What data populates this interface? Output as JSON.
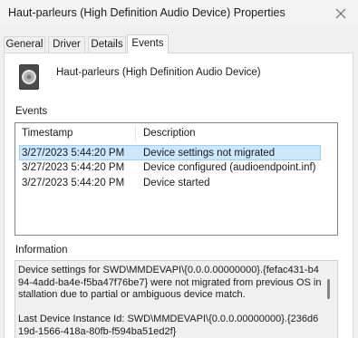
{
  "window": {
    "title": "Haut-parleurs (High Definition Audio Device) Properties",
    "close_icon": "close-icon"
  },
  "tabs": [
    {
      "label": "General",
      "active": false
    },
    {
      "label": "Driver",
      "active": false
    },
    {
      "label": "Details",
      "active": false
    },
    {
      "label": "Events",
      "active": true
    }
  ],
  "device": {
    "name": "Haut-parleurs (High Definition Audio Device)",
    "icon": "speaker-icon"
  },
  "events": {
    "section_label": "Events",
    "columns": [
      "Timestamp",
      "Description"
    ],
    "rows": [
      {
        "timestamp": "3/27/2023 5:44:20 PM",
        "description": "Device settings not migrated",
        "selected": true
      },
      {
        "timestamp": "3/27/2023 5:44:20 PM",
        "description": "Device configured (audioendpoint.inf)",
        "selected": false
      },
      {
        "timestamp": "3/27/2023 5:44:20 PM",
        "description": "Device started",
        "selected": false
      }
    ]
  },
  "information": {
    "section_label": "Information",
    "text": "Device settings for SWD\\MMDEVAPI\\{0.0.0.00000000}.{fefac431-b494-4add-ba4e-f5ba47f76be7} were not migrated from previous OS installation due to partial or ambiguous device match.\n\nLast Device Instance Id: SWD\\MMDEVAPI\\{0.0.0.00000000}.{236d619d-1566-418a-80fb-f594ba51ed2f}"
  },
  "colors": {
    "selection_fill": "#cce8ff",
    "selection_border": "#99d1ff",
    "window_bg": "#f0f0f0"
  }
}
